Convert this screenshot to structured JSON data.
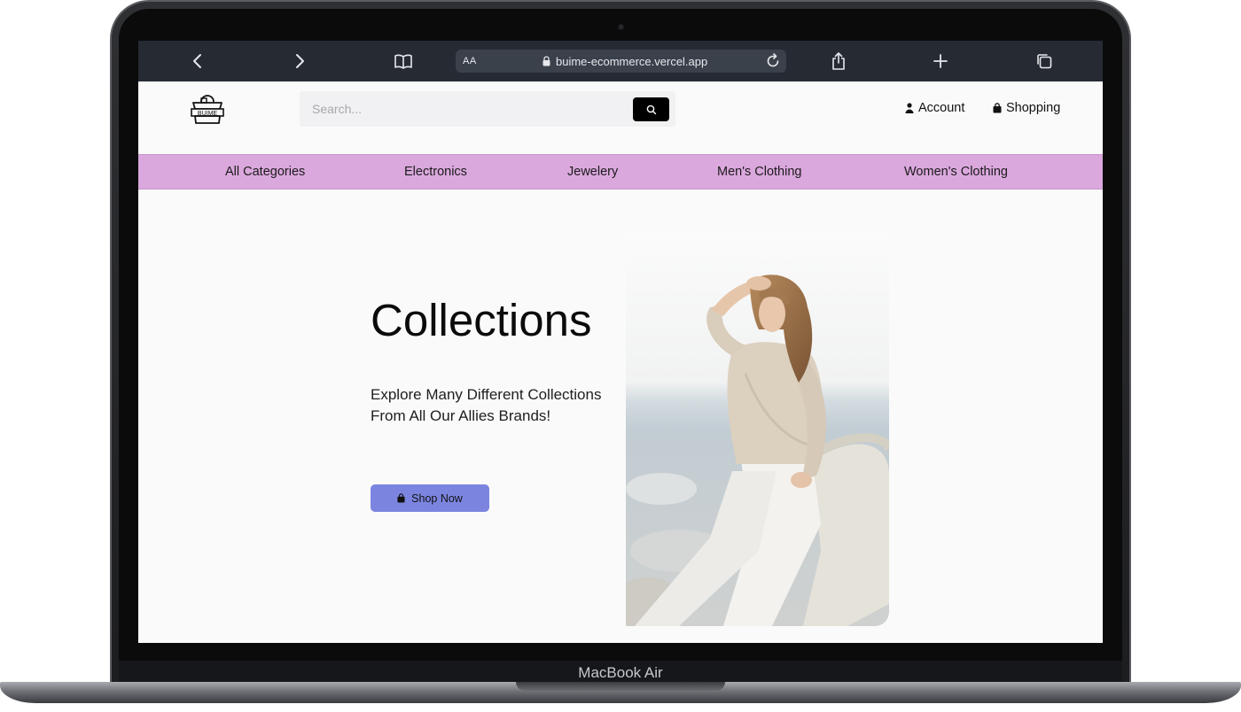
{
  "device": {
    "label": "MacBook Air"
  },
  "browser": {
    "text_size_label": "AA",
    "url": "buime-ecommerce.vercel.app"
  },
  "header": {
    "logo_text": "BUIME",
    "search": {
      "placeholder": "Search..."
    },
    "account_label": "Account",
    "shopping_label": "Shopping"
  },
  "nav": {
    "items": [
      {
        "label": "All Categories"
      },
      {
        "label": "Electronics"
      },
      {
        "label": "Jewelery"
      },
      {
        "label": "Men's Clothing"
      },
      {
        "label": "Women's Clothing"
      }
    ]
  },
  "hero": {
    "title": "Collections",
    "subtitle": "Explore Many Different Collections From All Our Allies Brands!",
    "cta_label": "Shop Now"
  },
  "colors": {
    "browser_bar": "#252a33",
    "nav_background": "#dba8de",
    "cta_background": "#7b85e0",
    "search_button": "#000000"
  },
  "icons": [
    "chevron-left-icon",
    "chevron-right-icon",
    "book-icon",
    "lock-icon",
    "reload-icon",
    "share-icon",
    "plus-icon",
    "tabs-icon",
    "search-icon",
    "user-icon",
    "bag-icon"
  ]
}
